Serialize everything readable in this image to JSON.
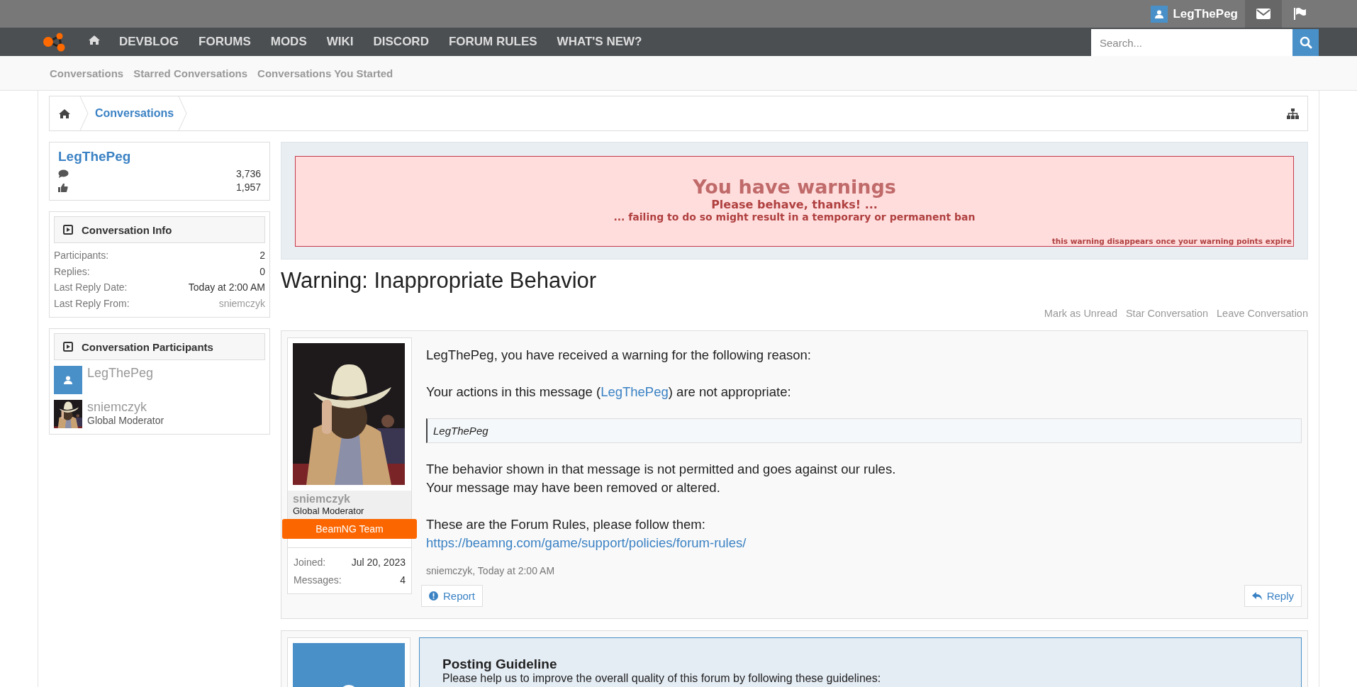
{
  "top_bar": {
    "user": "LegThePeg"
  },
  "nav": {
    "items": [
      "DEVBLOG",
      "FORUMS",
      "MODS",
      "WIKI",
      "DISCORD",
      "FORUM RULES",
      "WHAT'S NEW?"
    ],
    "search": {
      "placeholder": "Search..."
    }
  },
  "sub_nav": [
    "Conversations",
    "Starred Conversations",
    "Conversations You Started"
  ],
  "breadcrumb": [
    "Conversations"
  ],
  "sidebar": {
    "profile": {
      "name": "LegThePeg",
      "messages": "3,736",
      "likes": "1,957"
    },
    "info": {
      "title": "Conversation Info",
      "rows": [
        {
          "label": "Participants:",
          "value": "2",
          "kind": "text"
        },
        {
          "label": "Replies:",
          "value": "0",
          "kind": "text"
        },
        {
          "label": "Last Reply Date:",
          "value": "Today at 2:00 AM",
          "kind": "text"
        },
        {
          "label": "Last Reply From:",
          "value": "sniemczyk",
          "kind": "link"
        }
      ]
    },
    "participants": {
      "title": "Conversation Participants",
      "items": [
        {
          "name": "LegThePeg",
          "kind": "default"
        },
        {
          "name": "sniemczyk",
          "role": "Global Moderator",
          "kind": "picture"
        }
      ]
    }
  },
  "warning": {
    "title": "You have warnings",
    "line_1": "Please behave, thanks! ...",
    "line_2": "... failing to do so might result in a temporary or permanent ban",
    "note": "this warning disappears once your warning points expire"
  },
  "conversation_title": "Warning: Inappropriate Behavior",
  "actions": [
    "Mark as Unread",
    "Star Conversation",
    "Leave Conversation"
  ],
  "message": {
    "author": "sniemczyk",
    "role": "Global Moderator",
    "banner": "BeamNG Team",
    "stats": [
      {
        "label": "Joined:",
        "value": "Jul 20, 2023"
      },
      {
        "label": "Messages:",
        "value": "4"
      }
    ],
    "blocks": [
      {
        "kind": "para",
        "text": "LegThePeg, you have received a warning for the following reason:"
      },
      {
        "kind": "link_para",
        "before": "Your actions in this message (",
        "link": "LegThePeg",
        "after": ") are not appropriate:"
      },
      {
        "kind": "quote",
        "text": "LegThePeg"
      },
      {
        "kind": "line",
        "text": "The behavior shown in that message is not permitted and goes against our rules."
      },
      {
        "kind": "para",
        "text": "Your message may have been removed or altered."
      },
      {
        "kind": "line",
        "text": "These are the Forum Rules, please follow them:"
      },
      {
        "kind": "link",
        "text": "https://beamng.com/game/support/policies/forum-rules/"
      }
    ],
    "meta": "sniemczyk, Today at 2:00 AM",
    "report": "Report",
    "reply": "Reply"
  },
  "guideline": {
    "title": "Posting Guideline",
    "text": "Please help us to improve the overall quality of this forum by following these guidelines:"
  }
}
